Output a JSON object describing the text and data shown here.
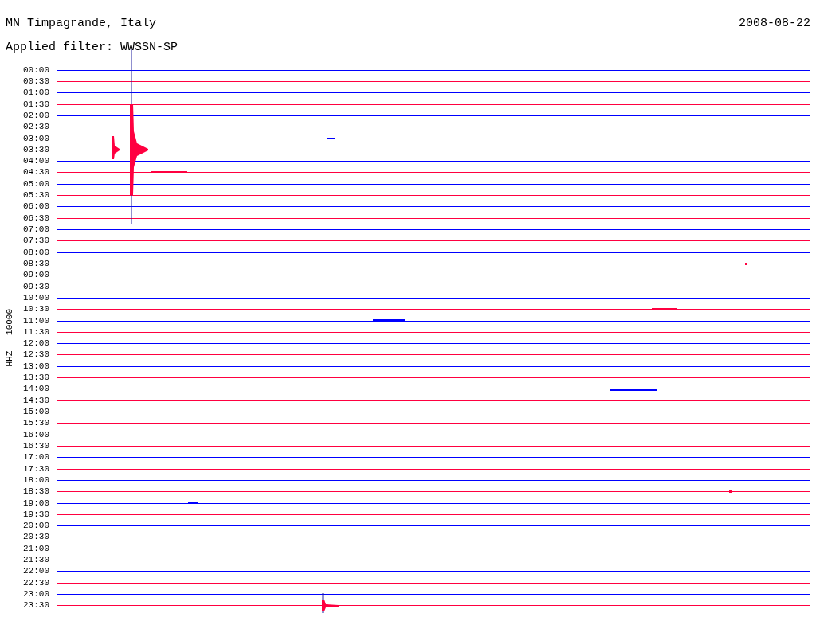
{
  "header": {
    "station": "MN Timpagrande, Italy",
    "date": "2008-08-22",
    "filter": "Applied filter: WWSSN-SP"
  },
  "axis_label": "HHZ - 10000",
  "traces": [
    {
      "label": "00:00",
      "color": "#0000ff"
    },
    {
      "label": "00:30",
      "color": "#ff0040"
    },
    {
      "label": "01:00",
      "color": "#0000ff"
    },
    {
      "label": "01:30",
      "color": "#ff0040"
    },
    {
      "label": "02:00",
      "color": "#0000ff"
    },
    {
      "label": "02:30",
      "color": "#ff0040"
    },
    {
      "label": "03:00",
      "color": "#0000ff"
    },
    {
      "label": "03:30",
      "color": "#ff0040"
    },
    {
      "label": "04:00",
      "color": "#0000ff"
    },
    {
      "label": "04:30",
      "color": "#ff0040"
    },
    {
      "label": "05:00",
      "color": "#0000ff"
    },
    {
      "label": "05:30",
      "color": "#ff0040"
    },
    {
      "label": "06:00",
      "color": "#0000ff"
    },
    {
      "label": "06:30",
      "color": "#ff0040"
    },
    {
      "label": "07:00",
      "color": "#0000ff"
    },
    {
      "label": "07:30",
      "color": "#ff0040"
    },
    {
      "label": "08:00",
      "color": "#0000ff"
    },
    {
      "label": "08:30",
      "color": "#ff0040"
    },
    {
      "label": "09:00",
      "color": "#0000ff"
    },
    {
      "label": "09:30",
      "color": "#ff0040"
    },
    {
      "label": "10:00",
      "color": "#0000ff"
    },
    {
      "label": "10:30",
      "color": "#ff0040"
    },
    {
      "label": "11:00",
      "color": "#0000ff"
    },
    {
      "label": "11:30",
      "color": "#ff0040"
    },
    {
      "label": "12:00",
      "color": "#0000ff"
    },
    {
      "label": "12:30",
      "color": "#ff0040"
    },
    {
      "label": "13:00",
      "color": "#0000ff"
    },
    {
      "label": "13:30",
      "color": "#ff0040"
    },
    {
      "label": "14:00",
      "color": "#0000ff"
    },
    {
      "label": "14:30",
      "color": "#ff0040"
    },
    {
      "label": "15:00",
      "color": "#0000ff"
    },
    {
      "label": "15:30",
      "color": "#ff0040"
    },
    {
      "label": "16:00",
      "color": "#0000ff"
    },
    {
      "label": "16:30",
      "color": "#ff0040"
    },
    {
      "label": "17:00",
      "color": "#0000ff"
    },
    {
      "label": "17:30",
      "color": "#ff0040"
    },
    {
      "label": "18:00",
      "color": "#0000ff"
    },
    {
      "label": "18:30",
      "color": "#ff0040"
    },
    {
      "label": "19:00",
      "color": "#0000ff"
    },
    {
      "label": "19:30",
      "color": "#ff0040"
    },
    {
      "label": "20:00",
      "color": "#0000ff"
    },
    {
      "label": "20:30",
      "color": "#ff0040"
    },
    {
      "label": "21:00",
      "color": "#0000ff"
    },
    {
      "label": "21:30",
      "color": "#ff0040"
    },
    {
      "label": "22:00",
      "color": "#0000ff"
    },
    {
      "label": "22:30",
      "color": "#ff0040"
    },
    {
      "label": "23:00",
      "color": "#0000ff"
    },
    {
      "label": "23:30",
      "color": "#ff0040"
    }
  ]
}
